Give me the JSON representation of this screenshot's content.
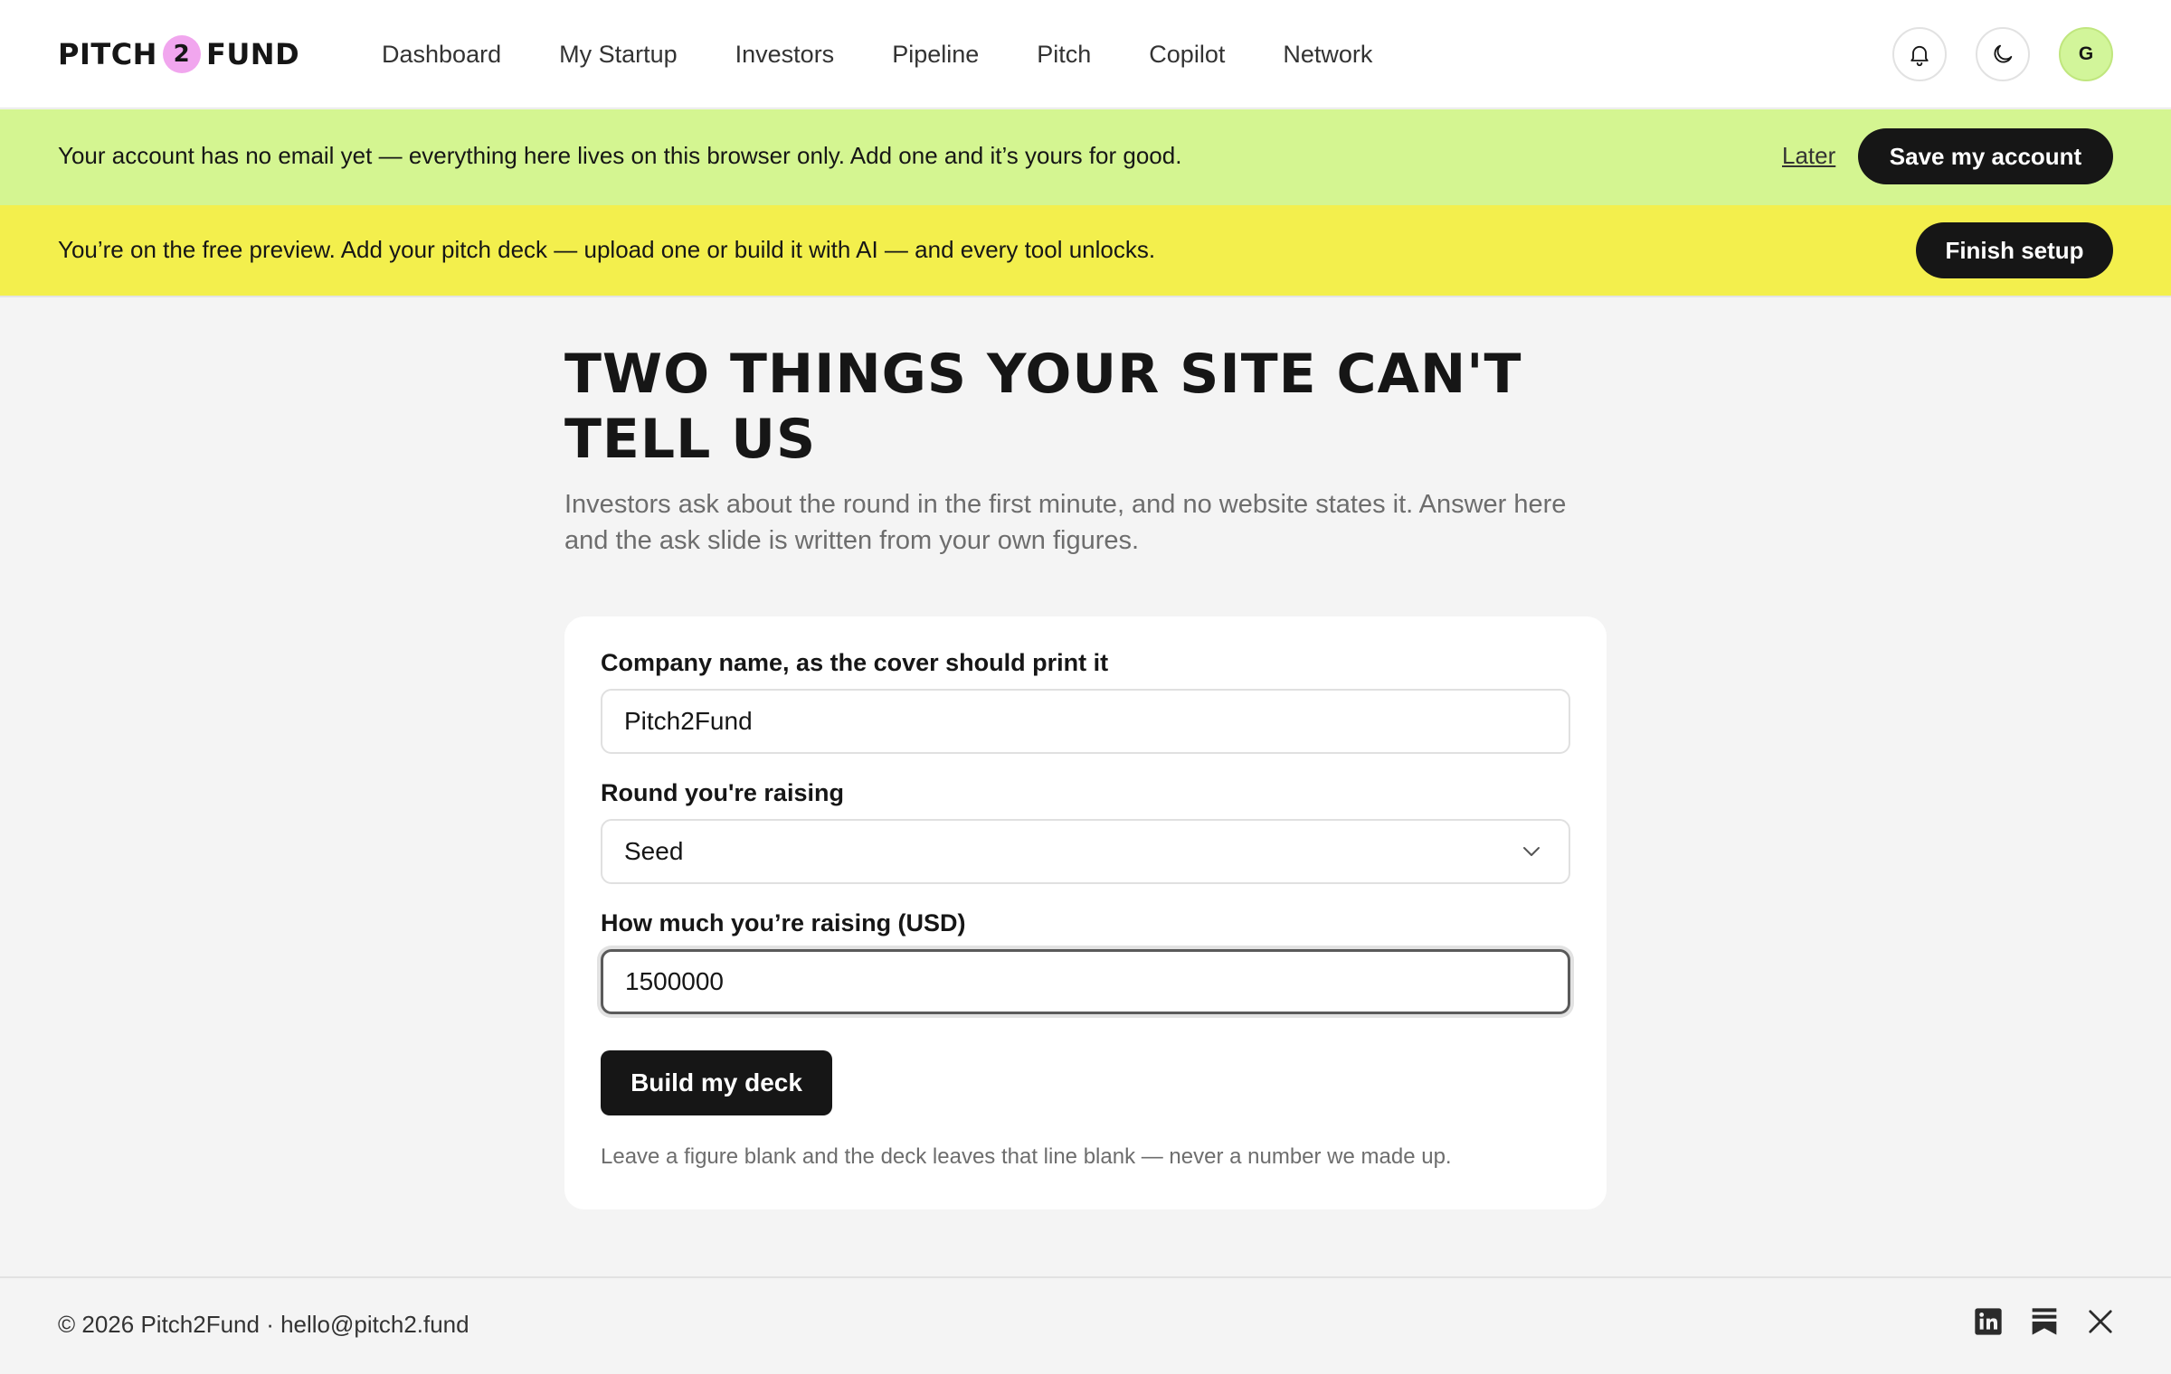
{
  "brand": {
    "left": "PITCH",
    "mid": "2",
    "right": "FUND",
    "accent": "#f1a6ee"
  },
  "nav": {
    "items": [
      "Dashboard",
      "My Startup",
      "Investors",
      "Pipeline",
      "Pitch",
      "Copilot",
      "Network"
    ]
  },
  "header": {
    "bell_icon": "bell-icon",
    "theme_icon": "moon-icon",
    "avatar_initial": "G",
    "avatar_color": "#d2f59a"
  },
  "banners": {
    "account": {
      "text": "Your account has no email yet — everything here lives on this browser only. Add one and it’s yours for good.",
      "later": "Later",
      "save": "Save my account",
      "color": "#d4f591"
    },
    "preview": {
      "text": "You’re on the free preview. Add your pitch deck — upload one or build it with AI — and every tool unlocks.",
      "finish": "Finish setup",
      "color": "#f3ef4d"
    }
  },
  "main": {
    "title_line1": "TWO THINGS YOUR SITE CAN'T",
    "title_line2": "TELL US",
    "subtitle_line1": "Investors ask about the round in the first minute, and no website states it. Answer here",
    "subtitle_line2": "and the ask slide is written from your own figures."
  },
  "form": {
    "company_label": "Company name, as the cover should print it",
    "company_value": "Pitch2Fund",
    "round_label": "Round you're raising",
    "round_value": "Seed",
    "amount_label": "How much you’re raising (USD)",
    "amount_value": "1500000",
    "submit": "Build my deck",
    "footnote": "Leave a figure blank and the deck leaves that line blank — never a number we made up."
  },
  "footer": {
    "text": "© 2026 Pitch2Fund · hello@pitch2.fund",
    "socials": [
      "linkedin-icon",
      "substack-icon",
      "x-icon"
    ]
  }
}
